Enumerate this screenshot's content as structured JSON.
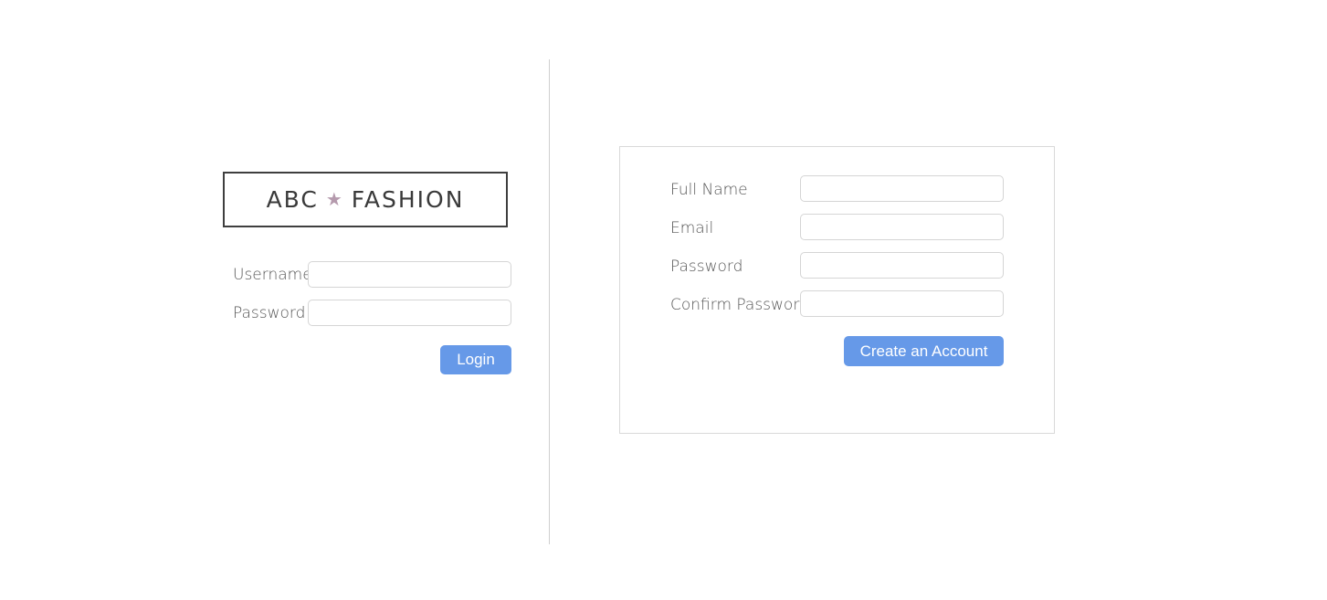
{
  "logo": {
    "left_text": "ABC",
    "star_glyph": "★",
    "right_text": "FASHION",
    "star_color": "#b59aad"
  },
  "login": {
    "username_label": "Username",
    "password_label": "Password",
    "username_value": "",
    "password_value": "",
    "login_button": "Login"
  },
  "register": {
    "full_name_label": "Full Name",
    "email_label": "Email",
    "password_label": "Password",
    "confirm_password_label": "Confirm Password",
    "full_name_value": "",
    "email_value": "",
    "password_value": "",
    "confirm_password_value": "",
    "create_button": "Create an Account"
  },
  "colors": {
    "accent": "#6699e8",
    "divider": "#cfcfcf",
    "border": "#d5d5d5"
  }
}
